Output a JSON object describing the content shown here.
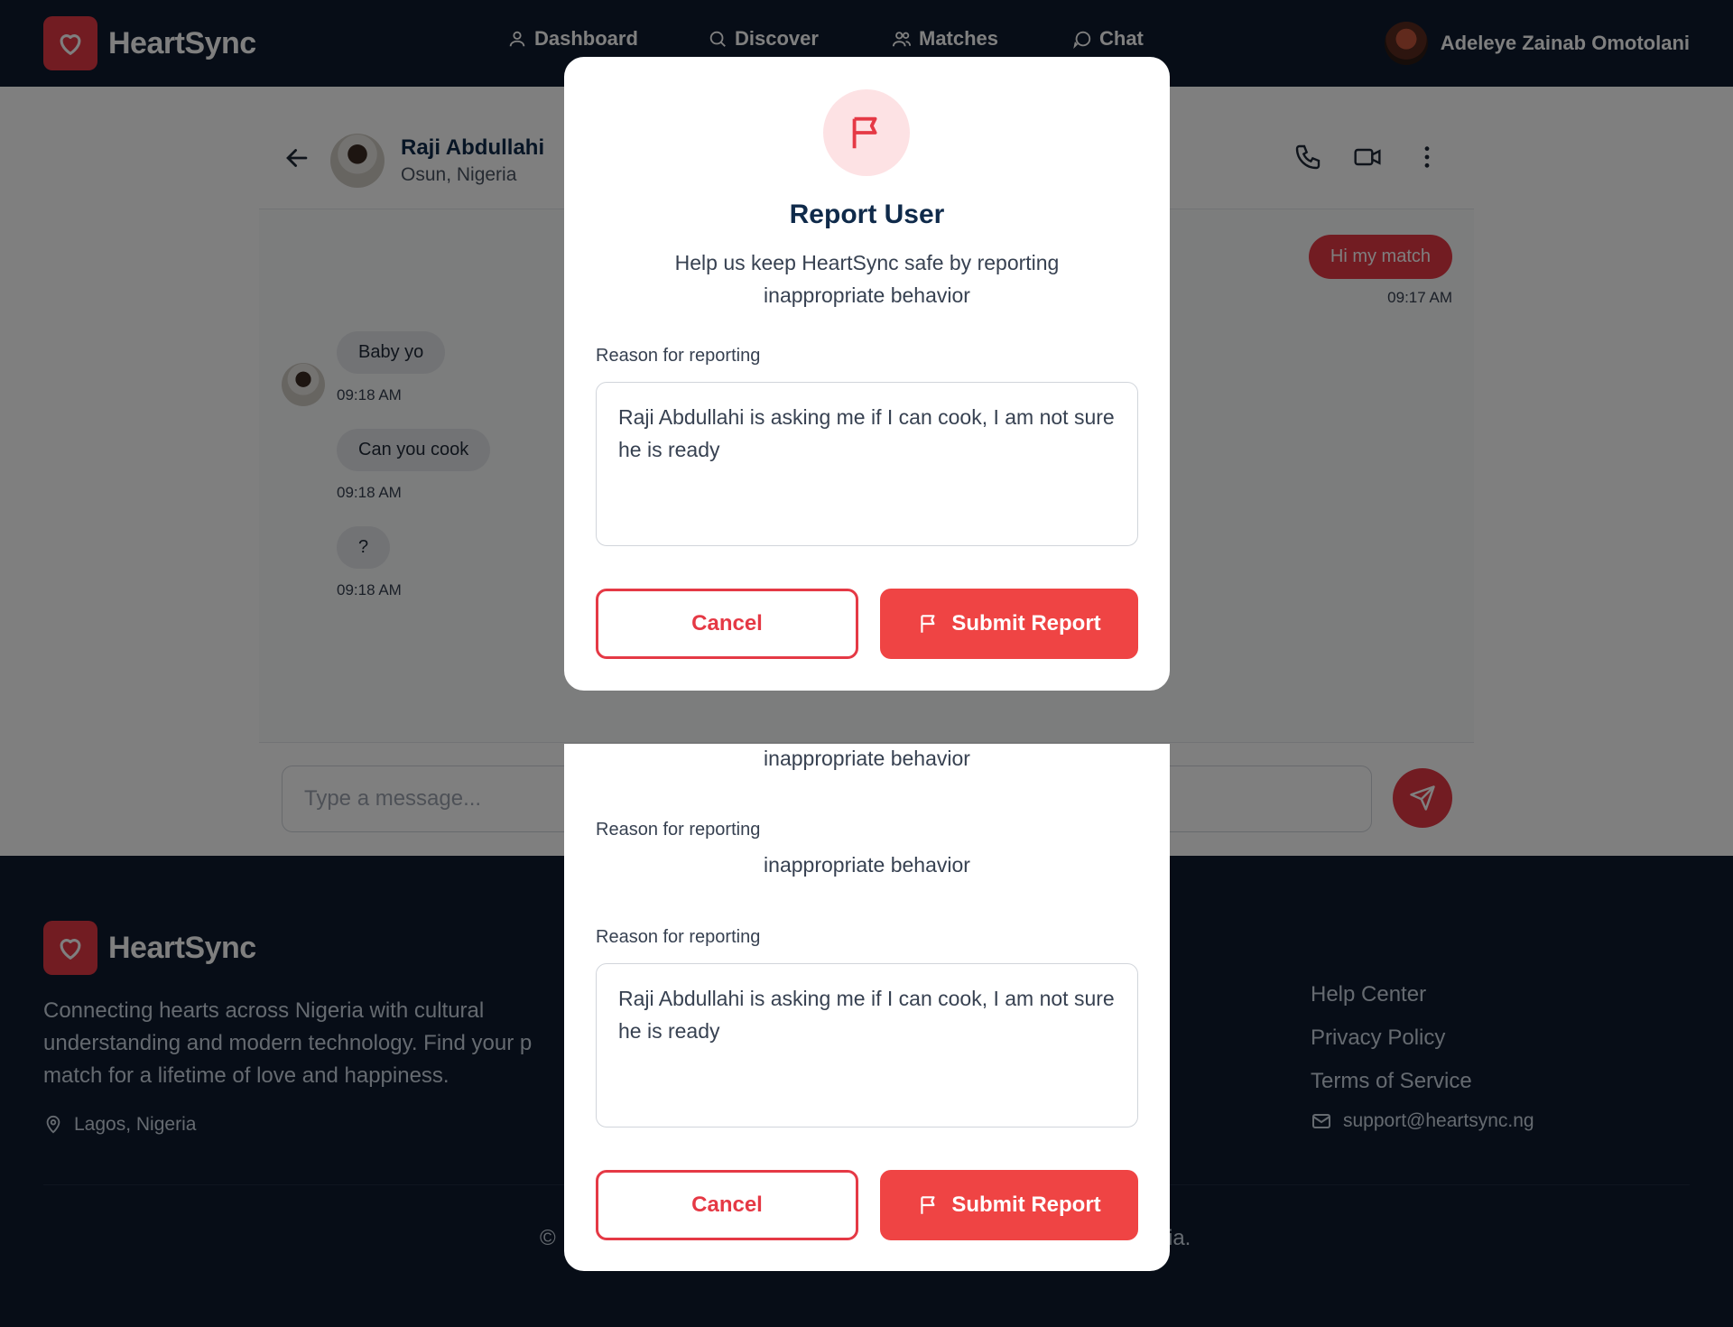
{
  "app": {
    "brand": "HeartSync",
    "accent_color": "#e53945",
    "navy_color": "#0f1a2e"
  },
  "nav": {
    "items": [
      {
        "label": "Dashboard",
        "icon": "user-icon"
      },
      {
        "label": "Discover",
        "icon": "search-icon"
      },
      {
        "label": "Matches",
        "icon": "users-icon"
      },
      {
        "label": "Chat",
        "icon": "chat-bubble-icon"
      }
    ],
    "user_name": "Adeleye Zainab Omotolani"
  },
  "chat": {
    "contact_name": "Raji Abdullahi",
    "contact_location": "Osun, Nigeria",
    "messages": [
      {
        "direction": "out",
        "text": "Hi my match",
        "time": "09:17 AM"
      },
      {
        "direction": "in",
        "text": "Baby yo",
        "time": "09:18 AM"
      },
      {
        "direction": "in",
        "text": "Can you cook",
        "time": "09:18 AM"
      },
      {
        "direction": "in",
        "text": "?",
        "time": "09:18 AM"
      }
    ],
    "composer_placeholder": "Type a message..."
  },
  "modal": {
    "title": "Report User",
    "subtitle": "Help us keep HeartSync safe by reporting inappropriate behavior",
    "subtitle_line2": "inappropriate behavior",
    "reason_label": "Reason for reporting",
    "reason_value": "Raji Abdullahi is asking me if I can cook, I am not sure he is ready",
    "cancel_label": "Cancel",
    "submit_label": "Submit Report"
  },
  "footer": {
    "brand": "HeartSync",
    "description": "Connecting hearts across Nigeria with cultural understanding and modern technology. Find your p",
    "description_line3": "match for a lifetime of love and happiness.",
    "location": "Lagos, Nigeria",
    "links": [
      "Help Center",
      "Privacy Policy",
      "Terms of Service"
    ],
    "email": "support@heartsync.ng",
    "copyright_left": "©",
    "copyright_right": "ia."
  }
}
